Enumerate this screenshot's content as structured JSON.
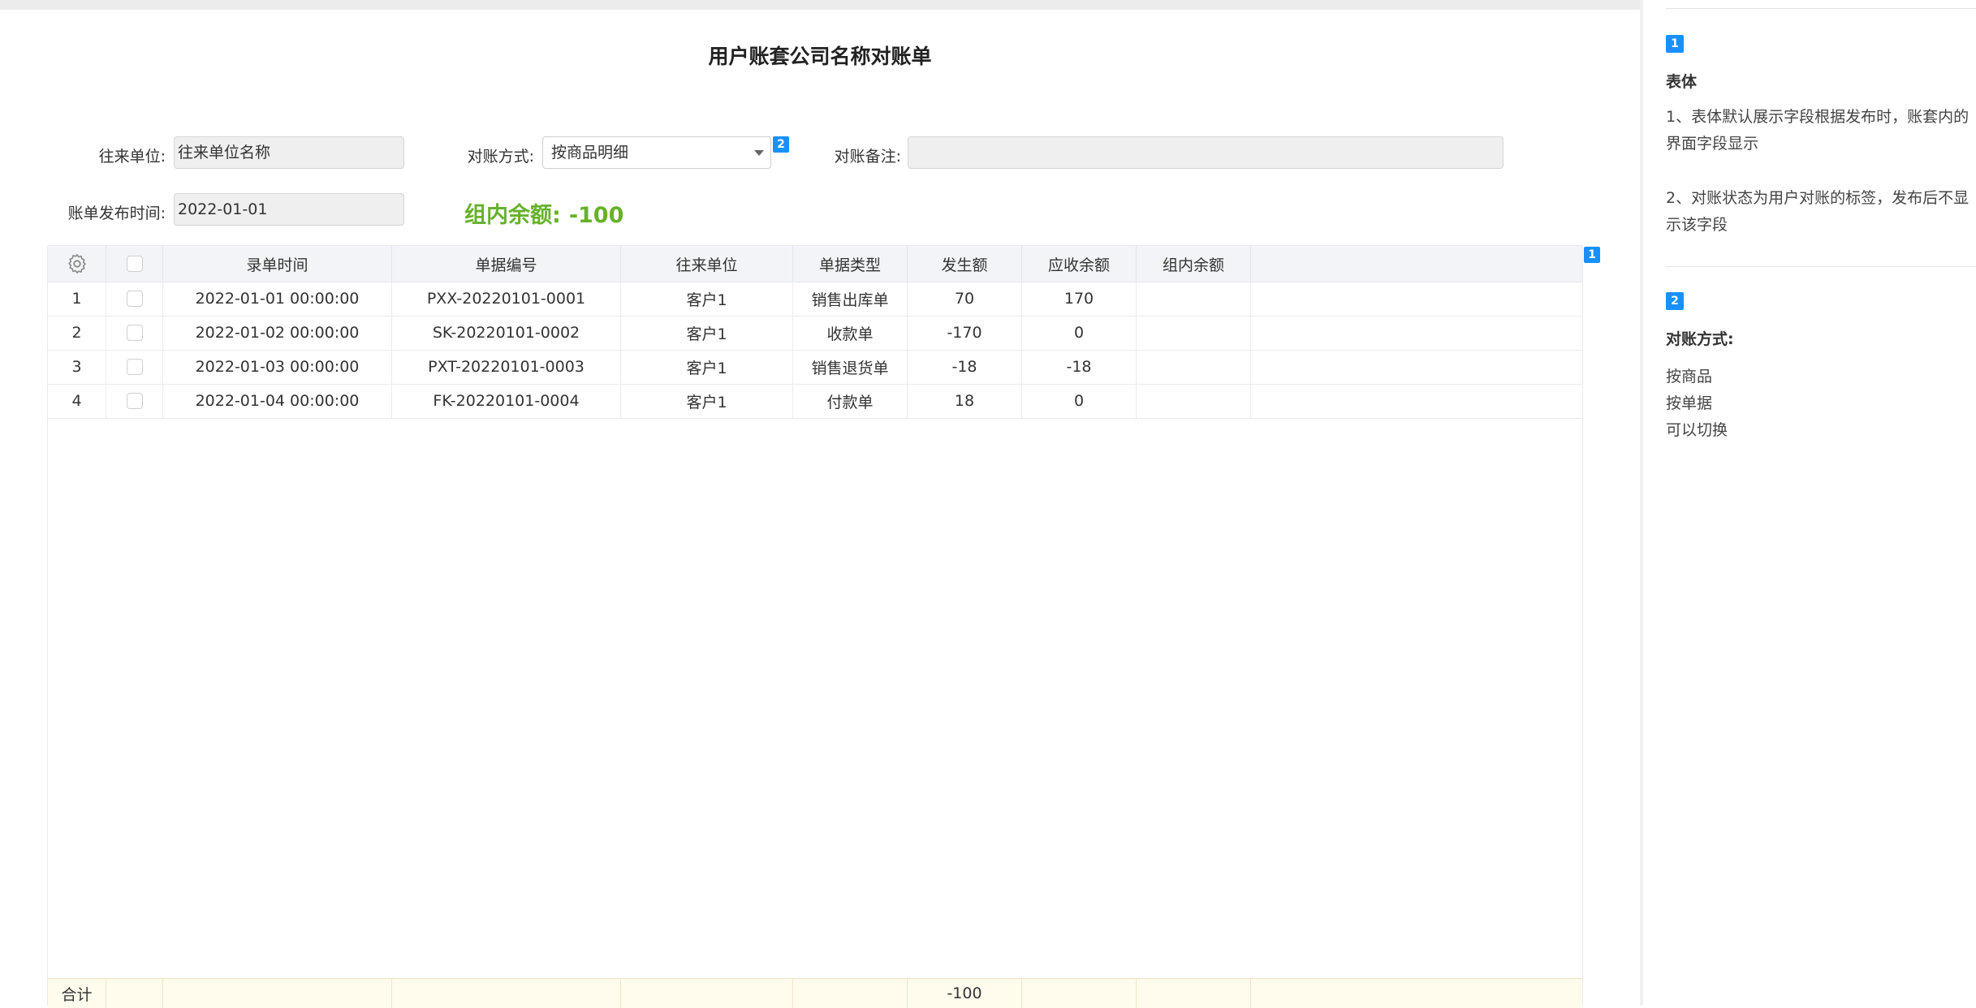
{
  "title": "用户账套公司名称对账单",
  "form": {
    "counterparty_label": "往来单位:",
    "counterparty_value": "往来单位名称",
    "method_label": "对账方式:",
    "method_value": "按商品明细",
    "note_label": "对账备注:",
    "note_value": "",
    "publish_time_label": "账单发布时间:",
    "publish_time_value": "2022-01-01",
    "group_balance_label": "组内余额:",
    "group_balance_value": "-100"
  },
  "badges": {
    "method": "2",
    "table": "1"
  },
  "table": {
    "columns": [
      "录单时间",
      "单据编号",
      "往来单位",
      "单据类型",
      "发生额",
      "应收余额",
      "组内余额"
    ],
    "rows": [
      {
        "no": "1",
        "time": "2022-01-01 00:00:00",
        "code": "PXX-20220101-0001",
        "unit": "客户1",
        "type": "销售出库单",
        "amount": "70",
        "receivable": "170",
        "group": ""
      },
      {
        "no": "2",
        "time": "2022-01-02 00:00:00",
        "code": "SK-20220101-0002",
        "unit": "客户1",
        "type": "收款单",
        "amount": "-170",
        "receivable": "0",
        "group": ""
      },
      {
        "no": "3",
        "time": "2022-01-03 00:00:00",
        "code": "PXT-20220101-0003",
        "unit": "客户1",
        "type": "销售退货单",
        "amount": "-18",
        "receivable": "-18",
        "group": ""
      },
      {
        "no": "4",
        "time": "2022-01-04 00:00:00",
        "code": "FK-20220101-0004",
        "unit": "客户1",
        "type": "付款单",
        "amount": "18",
        "receivable": "0",
        "group": ""
      }
    ],
    "footer": {
      "label": "合计",
      "amount": "-100"
    }
  },
  "notes": {
    "n1_badge": "1",
    "n1_title": "表体",
    "n1_p1": "1、表体默认展示字段根据发布时，账套内的界面字段显示",
    "n1_p2": "2、对账状态为用户对账的标签，发布后不显示该字段",
    "n2_badge": "2",
    "n2_title": "对账方式:",
    "n2_items": [
      "按商品",
      "按单据",
      "可以切换"
    ]
  },
  "colors": {
    "accent": "#1890ff",
    "balance_green": "#67b12b"
  }
}
